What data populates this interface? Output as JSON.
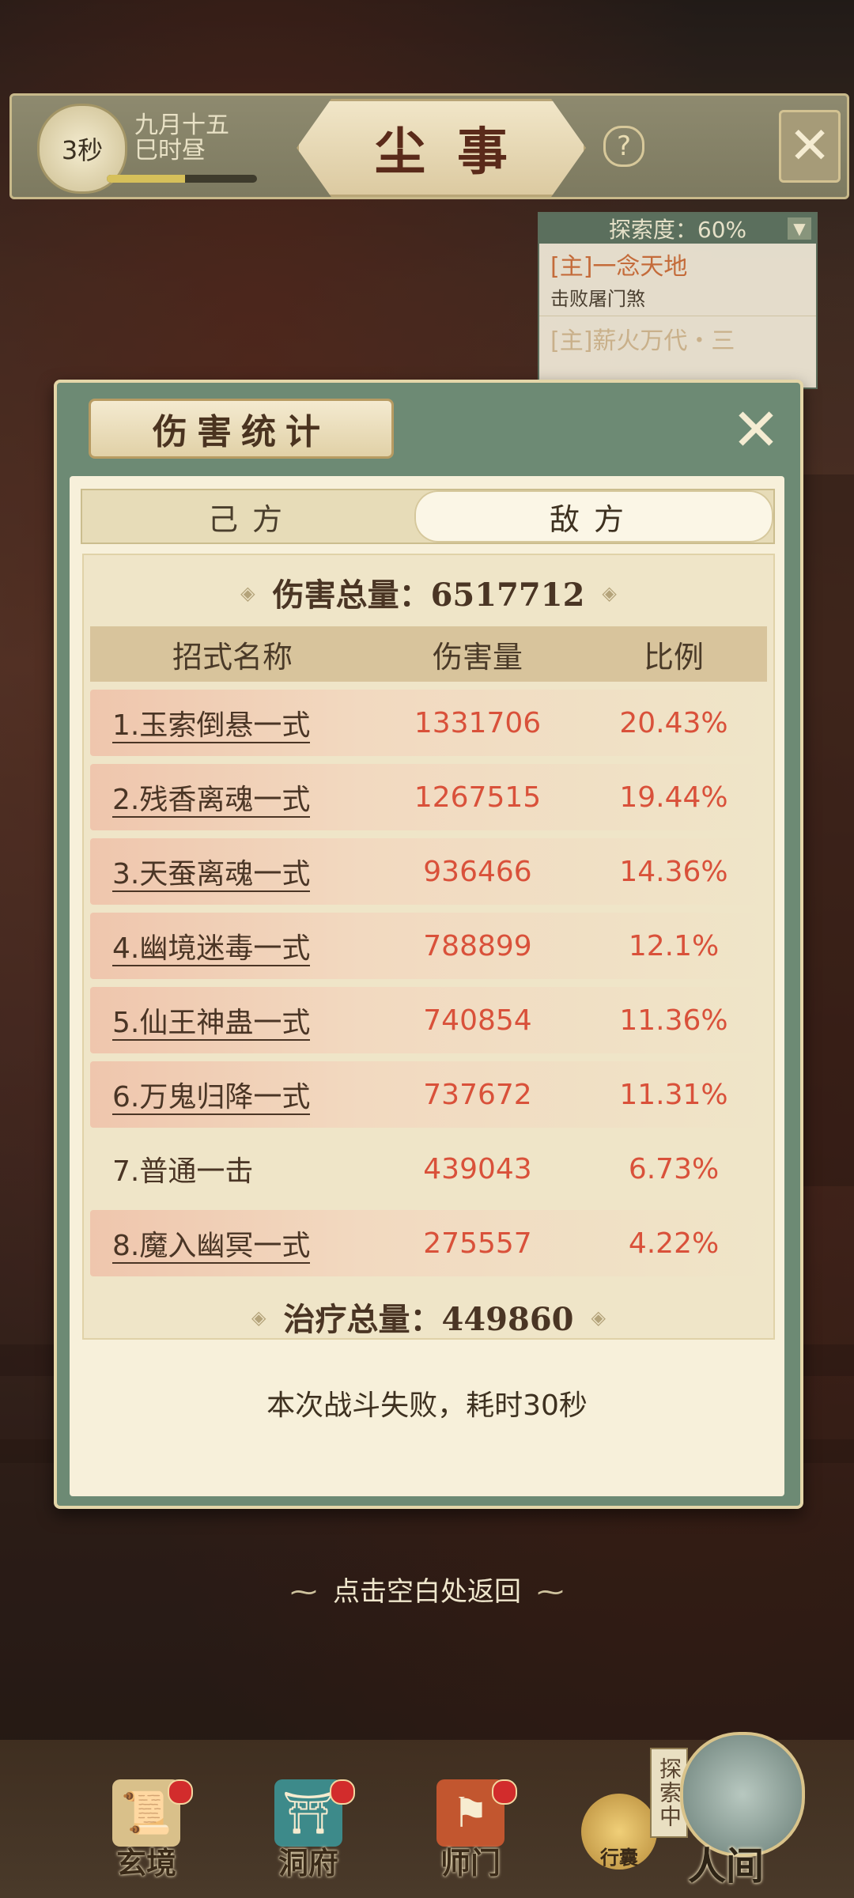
{
  "header": {
    "timer": "3秒",
    "date_line1": "九月十五",
    "date_line2": "巳时昼",
    "progress": 0.52,
    "title": "尘事",
    "help": "?"
  },
  "quest_panel": {
    "progress_label": "探索度：60%",
    "quest1_title": "[主]一念天地",
    "quest1_sub": "击败屠门煞",
    "quest2_title": "[主]薪火万代・三"
  },
  "dialog": {
    "title": "伤害统计",
    "tabs": [
      "己方",
      "敌方"
    ],
    "active_tab": "敌方",
    "damage_total_label": "伤害总量：6517712",
    "columns": [
      "招式名称",
      "伤害量",
      "比例"
    ],
    "rows": [
      {
        "name": "1.玉索倒悬一式",
        "damage": "1331706",
        "ratio": "20.43%"
      },
      {
        "name": "2.残香离魂一式",
        "damage": "1267515",
        "ratio": "19.44%"
      },
      {
        "name": "3.天蚕离魂一式",
        "damage": "936466",
        "ratio": "14.36%"
      },
      {
        "name": "4.幽境迷毒一式",
        "damage": "788899",
        "ratio": "12.1%"
      },
      {
        "name": "5.仙王神蛊一式",
        "damage": "740854",
        "ratio": "11.36%"
      },
      {
        "name": "6.万鬼归降一式",
        "damage": "737672",
        "ratio": "11.31%"
      },
      {
        "name": "7.普通一击",
        "damage": "439043",
        "ratio": "6.73%"
      },
      {
        "name": "8.魔入幽冥一式",
        "damage": "275557",
        "ratio": "4.22%"
      }
    ],
    "heal_total_label": "治疗总量：449860",
    "result_text": "本次战斗失败，耗时30秒"
  },
  "back_hint": "点击空白处返回",
  "bottom_nav": {
    "items": [
      "玄境",
      "洞府",
      "师门"
    ],
    "bag": "行囊",
    "explore_tag": "探索中",
    "human": "人间"
  },
  "colors": {
    "accent_red": "#d9513a",
    "panel_green": "#6d8a74",
    "paper": "#f7f0da"
  }
}
